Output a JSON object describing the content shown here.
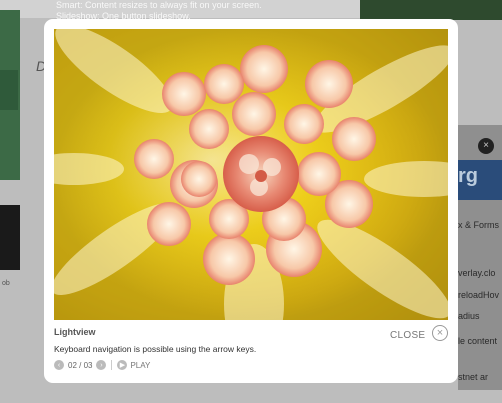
{
  "background_page": {
    "line1": "Smart: Content resizes to always fit on your screen.",
    "line2": "Slideshow: One button slideshow.",
    "side_heading": "D",
    "right_logo_text": "rg",
    "right_items": [
      "x & Forms",
      "verlay.clo",
      "reloadHov",
      "adius",
      "le content",
      "stnet ar"
    ],
    "left_caption": "ob"
  },
  "lightview": {
    "title": "Lightview",
    "description": "Keyboard navigation is possible using the arrow keys.",
    "counter": "02 / 03",
    "play_label": "PLAY",
    "close_label": "CLOSE",
    "icons": {
      "prev": "chevron-left-icon",
      "next": "chevron-right-icon",
      "play": "play-icon",
      "close": "close-icon"
    },
    "image_subject": "Dahlia flower close-up",
    "colors": {
      "petal_outer": "#f1d21c",
      "petal_inner": "#e8836d",
      "center": "#e06c55",
      "background": "#ffffff"
    }
  }
}
